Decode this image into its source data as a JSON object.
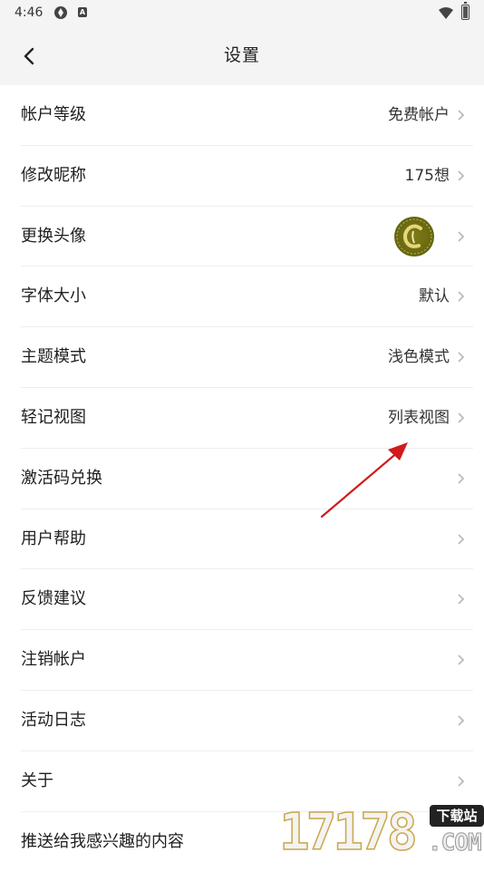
{
  "status_bar": {
    "time": "4:46"
  },
  "header": {
    "title": "设置"
  },
  "settings": [
    {
      "label": "帐户等级",
      "value": "免费帐户"
    },
    {
      "label": "修改昵称",
      "value": "175想"
    },
    {
      "label": "更换头像",
      "value": ""
    },
    {
      "label": "字体大小",
      "value": "默认"
    },
    {
      "label": "主题模式",
      "value": "浅色模式"
    },
    {
      "label": "轻记视图",
      "value": "列表视图"
    },
    {
      "label": "激活码兑换",
      "value": ""
    },
    {
      "label": "用户帮助",
      "value": ""
    },
    {
      "label": "反馈建议",
      "value": ""
    },
    {
      "label": "注销帐户",
      "value": ""
    },
    {
      "label": "活动日志",
      "value": ""
    },
    {
      "label": "关于",
      "value": ""
    },
    {
      "label": "推送给我感兴趣的内容",
      "value": ""
    }
  ],
  "watermark": {
    "digits": "17178",
    "tag": "下载站",
    "domain": ".COM"
  },
  "colors": {
    "background": "#ffffff",
    "header": "#f4f4f4",
    "arrow": "#d11a1a",
    "divider": "#eeeeee"
  }
}
